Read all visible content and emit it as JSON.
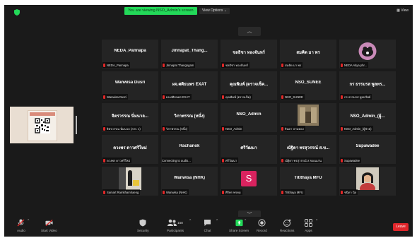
{
  "header": {
    "banner_text": "You are viewing NSO_Admin's screen",
    "view_options_label": "View Options",
    "view_button_label": "View"
  },
  "share": {
    "title": "ขอความร่วมมือ"
  },
  "grid_nav": {
    "up_label": "^",
    "down_label": "v"
  },
  "tiles": [
    {
      "name": "NEDA_Pannapa",
      "label": "NEDA_Pannapa"
    },
    {
      "name": "Jinnapat_Thang...",
      "label": "Jinnapat Thangngam"
    },
    {
      "name": "ชลธิชา ทองจันทร์",
      "label": "ชลธิชา ทองจันทร์"
    },
    {
      "name": "สมคิด มา พร",
      "label": "สมคิด มา พร"
    },
    {
      "name": "",
      "label": "NEDA Atiya phr..."
    },
    {
      "name": "Wanwisa Dusri",
      "label": "Wanwisa Dusri"
    },
    {
      "name": "ผจ.ศศิธนพร EXAT",
      "label": "ผจ.ศศิธนพร EXAT"
    },
    {
      "name": "คุณพิมพ์ (ตรวจเช็ค...",
      "label": "คุณพิมพ์ (ตรวจเช็ค)"
    },
    {
      "name": "NSO_SUNEE",
      "label": "NSO_SUNEE"
    },
    {
      "name": "กร ธรรมรส พูลทร...",
      "label": "กร ธรรมรส พูลทรัพย์"
    },
    {
      "name": "จิตรวรรณ นิ่มนวล...",
      "label": "จิตรวรรณ นิ่มนวล (ส.ท. 1)"
    },
    {
      "name": "วิภาพรรณ (หนึ่ง)",
      "label": "วิภาพรรณ (หนึ่ง)"
    },
    {
      "name": "NSO_Admin",
      "label": "NSO_Admin"
    },
    {
      "name": "",
      "label": "จินดา ปานทอง"
    },
    {
      "name": "NSO_Admin_(ผู้...",
      "label": "NSO_Admin_(ผู้ช่วย)"
    },
    {
      "name": "ดวงพร ดาวศรีใหม่",
      "label": "ดวงพร ดาวศรีใหม่"
    },
    {
      "name": "Rachanok",
      "label": "Connecting to audio..."
    },
    {
      "name": "ศรีวัฒนา",
      "label": "ศรีวัฒนา"
    },
    {
      "name": "ณัฐิดา พรสุวรรณ์ ส.ข...",
      "label": "ณัฐิดา พรสุวรรณ์ ส.ขอนแก่น"
    },
    {
      "name": "Supawadee",
      "label": "Supawadee"
    },
    {
      "name": "",
      "label": "Samart Ramkhamhaeng"
    },
    {
      "name": "Wanwisa (NHK)",
      "label": "Wanwisa (NHK)"
    },
    {
      "name": "",
      "label": "ศิริพร พรหม"
    },
    {
      "name": "Titithaya MFU",
      "label": "Titithaya MFU"
    },
    {
      "name": "",
      "label": "ชนิดา นิล"
    }
  ],
  "avatar_letter": "S",
  "toolbar": {
    "audio": "Audio",
    "video": "Start Video",
    "security": "Security",
    "participants": "Participants",
    "participants_count": "158",
    "chat": "Chat",
    "share_screen": "Share Screen",
    "record": "Record",
    "reactions": "Reactions",
    "apps": "Apps",
    "leave": "Leave"
  },
  "colors": {
    "banner": "#23d959",
    "share_screen": "#23d959",
    "leave": "#e0262b",
    "avatar_pink": "#d9235f"
  }
}
